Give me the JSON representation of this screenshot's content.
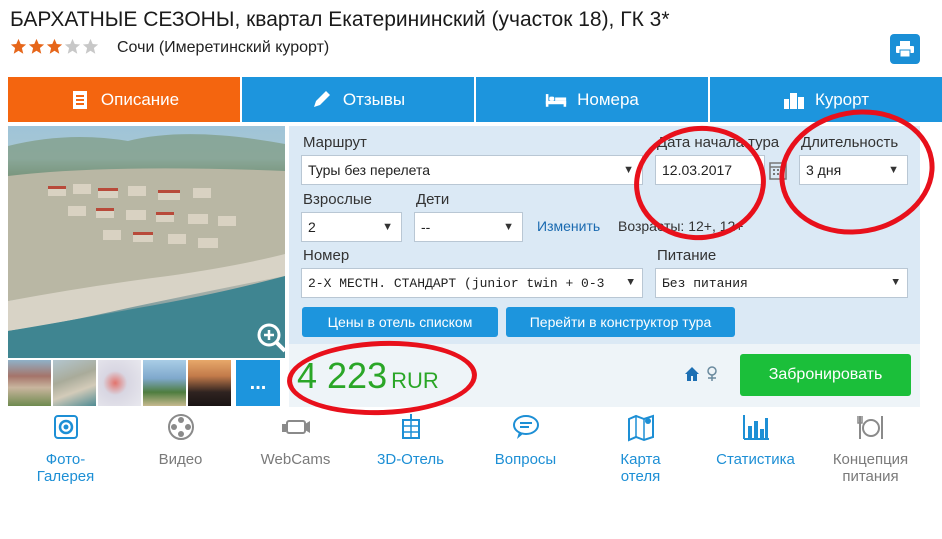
{
  "hotel": {
    "title": "БАРХАТНЫЕ СЕЗОНЫ, квартал Екатерининский (участок 18), ГК 3*",
    "stars_filled": 3,
    "stars_total": 5,
    "location": "Сочи (Имеретинский курорт)"
  },
  "tabs": [
    {
      "label": "Описание",
      "icon": "document-icon",
      "active": true
    },
    {
      "label": "Отзывы",
      "icon": "pencil-icon",
      "active": false
    },
    {
      "label": "Номера",
      "icon": "bed-icon",
      "active": false
    },
    {
      "label": "Курорт",
      "icon": "city-icon",
      "active": false
    }
  ],
  "gallery": {
    "more_label": "...",
    "thumb_count": 5
  },
  "form": {
    "route_label": "Маршрут",
    "route_value": "Туры без перелета",
    "start_date_label": "Дата начала тура",
    "start_date_value": "12.03.2017",
    "duration_label": "Длительность",
    "duration_value": "3 дня",
    "adults_label": "Взрослые",
    "adults_value": "2",
    "children_label": "Дети",
    "children_value": "--",
    "change_link": "Изменить",
    "ages_text": "Возрасты: 12+, 12+",
    "room_label": "Номер",
    "room_value": "2-Х МЕСТН. СТАНДАРТ (junior twin + 0-3",
    "meal_label": "Питание",
    "meal_value": "Без питания",
    "list_prices_button": "Цены в отель списком",
    "constructor_button": "Перейти в конструктор тура"
  },
  "price": {
    "amount": "4 223",
    "currency": "RUR"
  },
  "book_button": "Забронировать",
  "bottom_nav": [
    {
      "label1": "Фото-",
      "label2": "Галерея",
      "icon": "camera-icon",
      "color": "blue"
    },
    {
      "label1": "Видео",
      "label2": "",
      "icon": "film-reel-icon",
      "color": "grey"
    },
    {
      "label1": "WebCams",
      "label2": "",
      "icon": "webcam-icon",
      "color": "grey"
    },
    {
      "label1": "3D-Отель",
      "label2": "",
      "icon": "3d-hotel-icon",
      "color": "blue"
    },
    {
      "label1": "Вопросы",
      "label2": "",
      "icon": "chat-icon",
      "color": "blue"
    },
    {
      "label1": "Карта",
      "label2": "отеля",
      "icon": "map-icon",
      "color": "blue"
    },
    {
      "label1": "Статистика",
      "label2": "",
      "icon": "bar-chart-icon",
      "color": "blue"
    },
    {
      "label1": "Концепция",
      "label2": "питания",
      "icon": "cutlery-icon",
      "color": "grey"
    }
  ],
  "colors": {
    "tab_active": "#f4650f",
    "tab_normal": "#1d95dd",
    "price_green": "#2aa627",
    "book_green": "#1bbf3a",
    "annotation_red": "#e8101b"
  }
}
